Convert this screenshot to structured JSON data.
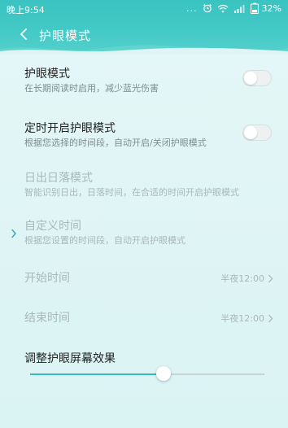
{
  "status_bar": {
    "time": "晚上9:54",
    "more_indicator": "...",
    "battery_percent": "32%",
    "icons": [
      "alarm-icon",
      "wifi-icon",
      "signal-icon",
      "battery-icon"
    ]
  },
  "header": {
    "title": "护眼模式",
    "back_icon": "back-arrow-icon"
  },
  "settings": {
    "eye_mode": {
      "title": "护眼模式",
      "subtitle": "在长期阅读时启用，减少蓝光伤害",
      "enabled": false
    },
    "scheduled": {
      "title": "定时开启护眼模式",
      "subtitle": "根据您选择的时间段，自动开启/关闭护眼模式",
      "enabled": false
    },
    "sunset": {
      "title": "日出日落模式",
      "subtitle": "智能识别日出，日落时间，在合适的时间开启护眼模式"
    },
    "custom": {
      "title": "自定义时间",
      "subtitle": "根据您设置的时间段，自动开启护眼模式"
    },
    "start_time": {
      "label": "开始时间",
      "value": "半夜12:00"
    },
    "end_time": {
      "label": "结束时间",
      "value": "半夜12:00"
    },
    "effect": {
      "label": "调整护眼屏幕效果",
      "level": 0.57
    }
  },
  "colors": {
    "header": "#43c9c6",
    "background": "#dff4f4",
    "accent": "#39b8c0"
  }
}
